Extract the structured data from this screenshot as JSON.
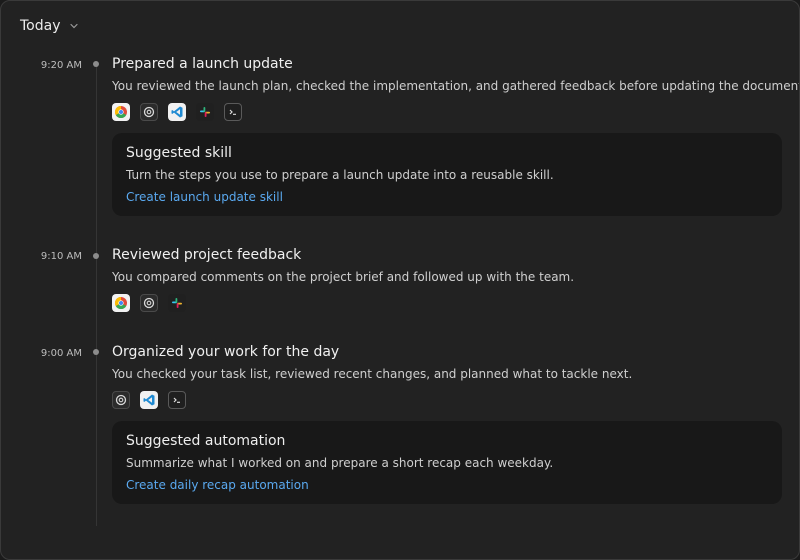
{
  "header": {
    "title": "Today"
  },
  "entries": [
    {
      "time": "9:20 AM",
      "title": "Prepared a launch update",
      "description": "You reviewed the launch plan, checked the implementation, and gathered feedback before updating the documentation.",
      "apps": [
        "chrome-icon",
        "openai-icon",
        "vscode-icon",
        "slack-icon",
        "terminal-icon"
      ],
      "card": {
        "title": "Suggested skill",
        "description": "Turn the steps you use to prepare a launch update into a reusable skill.",
        "link": "Create launch update skill"
      }
    },
    {
      "time": "9:10 AM",
      "title": "Reviewed project feedback",
      "description": "You compared comments on the project brief and followed up with the team.",
      "apps": [
        "chrome-icon",
        "openai-icon",
        "slack-icon"
      ]
    },
    {
      "time": "9:00 AM",
      "title": "Organized your work for the day",
      "description": "You checked your task list, reviewed recent changes, and planned what to tackle next.",
      "apps": [
        "openai-icon",
        "vscode-icon",
        "terminal-icon"
      ],
      "card": {
        "title": "Suggested automation",
        "description": "Summarize what I worked on and prepare a short recap each weekday.",
        "link": "Create daily recap automation"
      }
    }
  ],
  "colors": {
    "link": "#5aa9f0",
    "background": "#222222",
    "card": "#181818"
  }
}
